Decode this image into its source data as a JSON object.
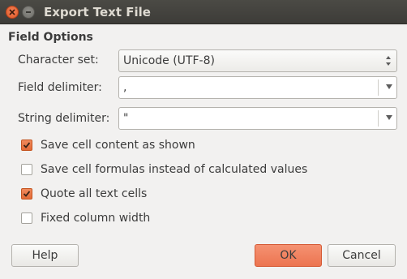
{
  "window": {
    "title": "Export Text File",
    "controls": {
      "close_icon": "close-icon",
      "minimize_icon": "minimize-icon"
    }
  },
  "section": {
    "title": "Field Options"
  },
  "fields": {
    "character_set": {
      "label": "Character set:",
      "value": "Unicode (UTF-8)"
    },
    "field_delimiter": {
      "label": "Field delimiter:",
      "value": ","
    },
    "string_delimiter": {
      "label": "String delimiter:",
      "value": "\""
    }
  },
  "options": [
    {
      "label": "Save cell content as shown",
      "checked": true
    },
    {
      "label": "Save cell formulas instead of calculated values",
      "checked": false
    },
    {
      "label": "Quote all text cells",
      "checked": true
    },
    {
      "label": "Fixed column width",
      "checked": false
    }
  ],
  "buttons": {
    "help": "Help",
    "ok": "OK",
    "cancel": "Cancel"
  },
  "colors": {
    "accent": "#e8673a",
    "titlebar": "#3f3e3a",
    "background": "#f2f1f0"
  }
}
